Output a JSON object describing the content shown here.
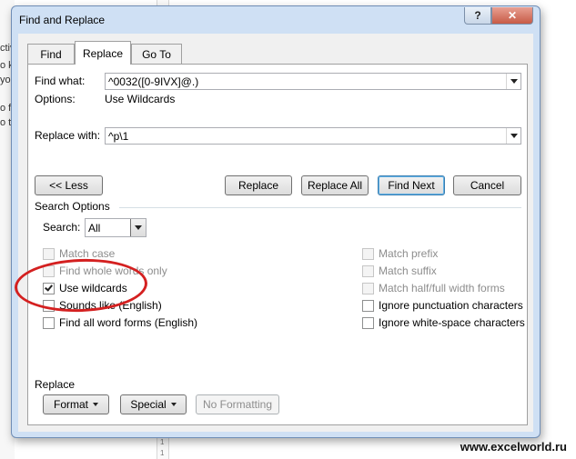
{
  "background": {
    "fragments": [
      "ctiv",
      "o k",
      "yo",
      "o f",
      "o t"
    ],
    "ruler_numbers": [
      "1",
      "1"
    ],
    "watermark": "www.excelworld.ru"
  },
  "dialog": {
    "title": "Find and Replace",
    "help_label": "?",
    "close_label": "✕",
    "tabs": [
      {
        "label": "Find",
        "key": "F",
        "active": false
      },
      {
        "label": "Replace",
        "key": "p",
        "active": true
      },
      {
        "label": "Go To",
        "key": "G",
        "active": false
      }
    ],
    "find": {
      "label": "Find what:",
      "value": "^0032([0-9IVX]@.)"
    },
    "options": {
      "label": "Options:",
      "value": "Use Wildcards"
    },
    "replace": {
      "label": "Replace with:",
      "value": "^p\\1"
    },
    "buttons": {
      "less": "<< Less",
      "replace": "Replace",
      "replace_all": "Replace All",
      "find_next": "Find Next",
      "cancel": "Cancel"
    },
    "search_options": {
      "title": "Search Options",
      "search_label": "Search:",
      "search_value": "All",
      "left": [
        {
          "label": "Match case",
          "checked": false,
          "disabled": true
        },
        {
          "label": "Find whole words only",
          "checked": false,
          "disabled": true
        },
        {
          "label": "Use wildcards",
          "checked": true,
          "disabled": false
        },
        {
          "label": "Sounds like (English)",
          "checked": false,
          "disabled": false
        },
        {
          "label": "Find all word forms (English)",
          "checked": false,
          "disabled": false
        }
      ],
      "right": [
        {
          "label": "Match prefix",
          "checked": false,
          "disabled": true
        },
        {
          "label": "Match suffix",
          "checked": false,
          "disabled": true
        },
        {
          "label": "Match half/full width forms",
          "checked": false,
          "disabled": true
        },
        {
          "label": "Ignore punctuation characters",
          "checked": false,
          "disabled": false
        },
        {
          "label": "Ignore white-space characters",
          "checked": false,
          "disabled": false
        }
      ]
    },
    "replace_section": {
      "title": "Replace",
      "format": "Format",
      "special": "Special",
      "no_formatting": "No Formatting"
    }
  }
}
